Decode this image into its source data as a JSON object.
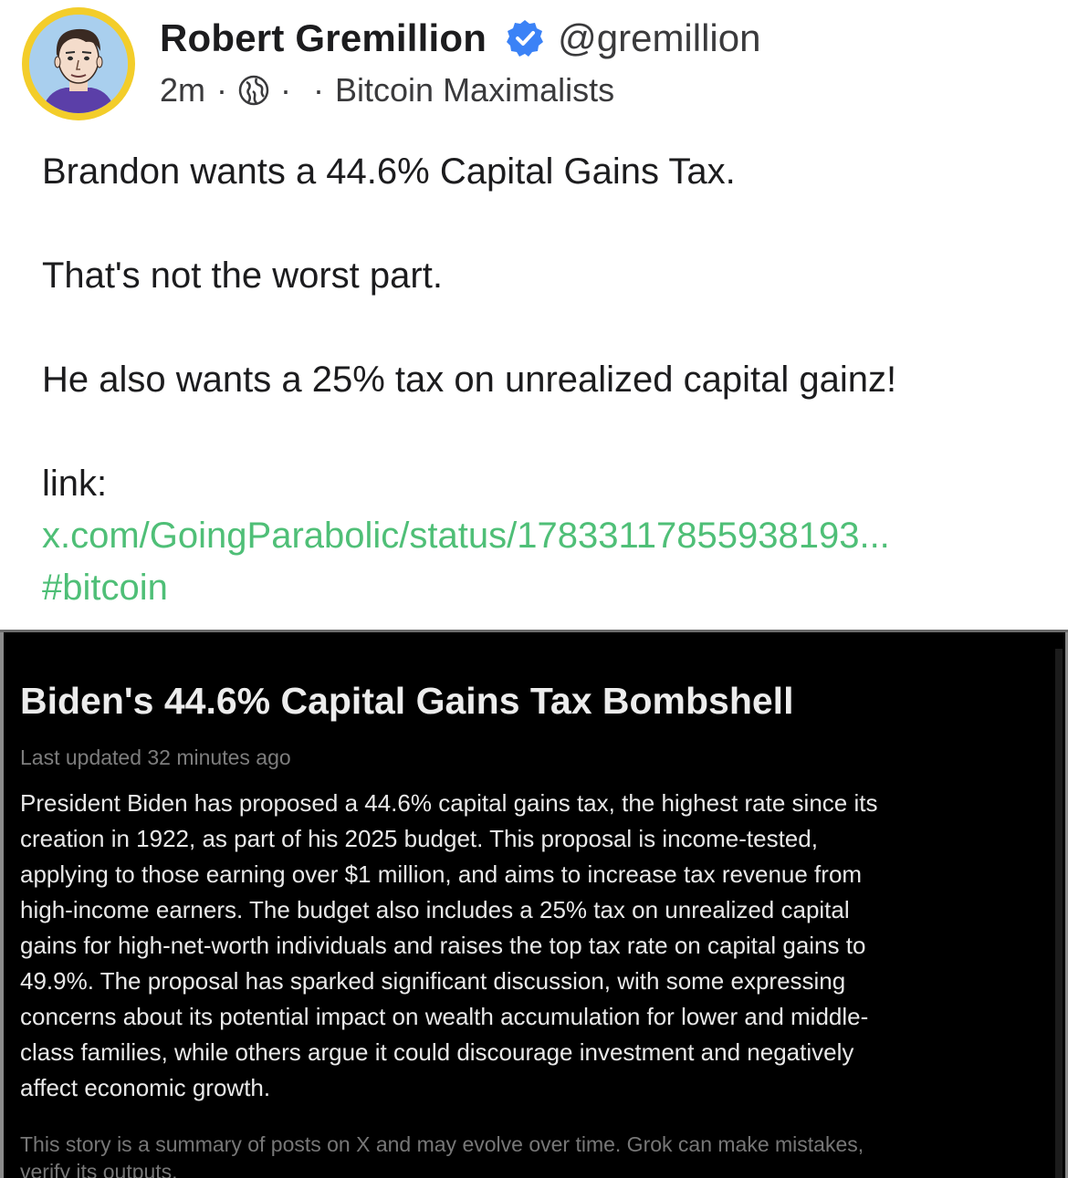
{
  "author": {
    "name": "Robert Gremillion",
    "handle": "@gremillion",
    "verified_color": "#3b82f6",
    "avatar_icon": "cartoon-portrait-avatar"
  },
  "meta": {
    "time": "2m",
    "sep1": "·",
    "visibility_icon": "globe-icon",
    "sep2": "·",
    "sep3": "·",
    "group": "Bitcoin Maximalists"
  },
  "post": {
    "line1": "Brandon wants a 44.6% Capital Gains Tax.",
    "line2": "That's not the worst part.",
    "line3": "He also wants a 25% tax on unrealized capital gainz!",
    "link_label": "link:",
    "link_url": "x.com/GoingParabolic/status/17833117855938193...",
    "hashtag": "#bitcoin",
    "link_color": "#4fbf77"
  },
  "embedded_card": {
    "title": "Biden's 44.6% Capital Gains Tax Bombshell",
    "updated": "Last updated 32 minutes ago",
    "summary_lines": [
      "President Biden has proposed a 44.6% capital gains tax, the highest rate since its",
      "creation in 1922, as part of his 2025 budget. This proposal is income-tested,",
      "applying to those earning over $1 million, and aims to increase tax revenue from",
      "high-income earners. The budget also includes a 25% tax on unrealized capital",
      "gains for high-net-worth individuals and raises the top tax rate on capital gains to",
      "49.9%. The proposal has sparked significant discussion, with some expressing",
      "concerns about its potential impact on wealth accumulation for lower and middle-",
      "class families, while others argue it could discourage investment and negatively",
      "affect economic growth."
    ],
    "disclaimer_lines": [
      "This story is a summary of posts on X and may evolve over time. Grok can make mistakes,",
      "verify its outputs."
    ],
    "background": "#000000"
  }
}
